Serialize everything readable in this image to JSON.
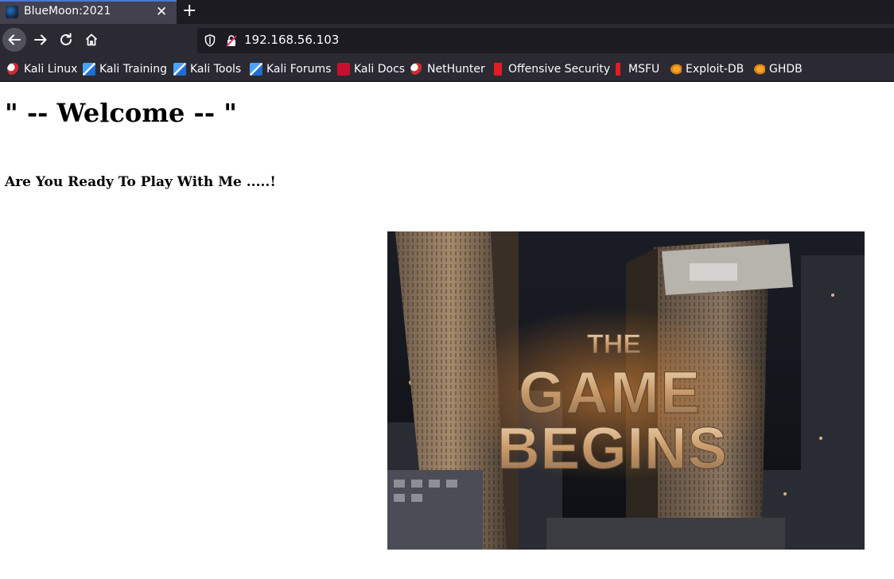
{
  "browser": {
    "tab": {
      "title": "BlueMoon:2021",
      "close": "✕"
    },
    "new_tab": "+",
    "url": "192.168.56.103",
    "bookmarks": [
      {
        "label": "Kali Linux",
        "icon": "kali-dragon-icon"
      },
      {
        "label": "Kali Training",
        "icon": "kali-training-icon"
      },
      {
        "label": "Kali Tools",
        "icon": "kali-tools-icon"
      },
      {
        "label": "Kali Forums",
        "icon": "kali-forums-icon"
      },
      {
        "label": "Kali Docs",
        "icon": "kali-docs-icon"
      },
      {
        "label": "NetHunter",
        "icon": "nethunter-icon"
      },
      {
        "label": "Offensive Security",
        "icon": "offsec-icon"
      },
      {
        "label": "MSFU",
        "icon": "msfu-icon"
      },
      {
        "label": "Exploit-DB",
        "icon": "exploit-db-icon"
      },
      {
        "label": "GHDB",
        "icon": "ghdb-icon"
      }
    ]
  },
  "page": {
    "heading": "\" -- Welcome -- \"",
    "subheading": "Are You Ready To Play With Me .....!",
    "hero_image": {
      "line1": "THE",
      "line2": "GAME",
      "line3": "BEGINS"
    }
  },
  "colors": {
    "tab_bar": "#1c1b22",
    "toolbar": "#2b2a33",
    "active_tab": "#42414d",
    "tab_accent": "#4a77d4",
    "text_light": "#fbfbfe",
    "page_bg": "#ffffff"
  }
}
